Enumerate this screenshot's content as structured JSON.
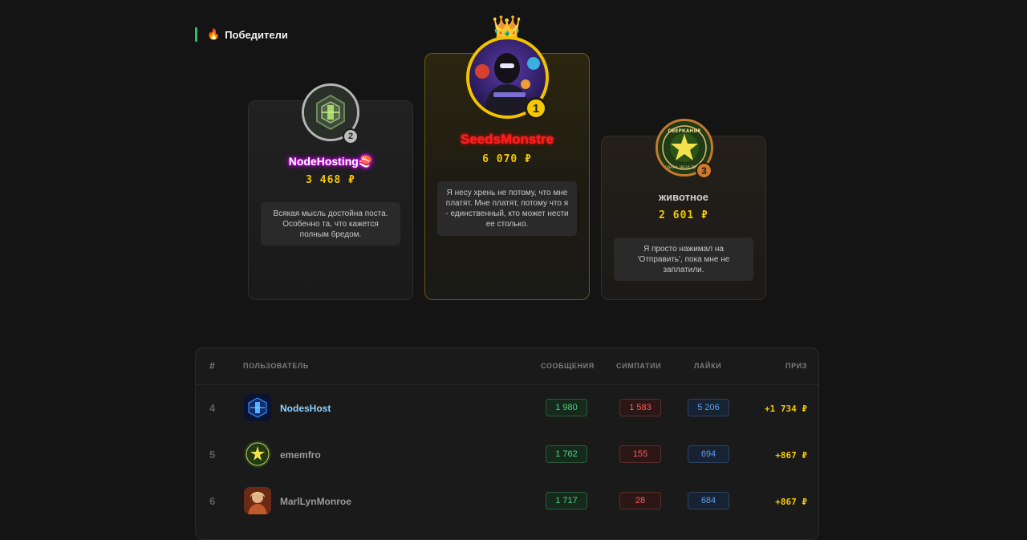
{
  "section": {
    "icon": "fire-icon",
    "icon_glyph": "🔥",
    "title": "Победители"
  },
  "podium": {
    "crown_glyph": "👑",
    "first": {
      "rank": "1",
      "name": "SeedsMonstre",
      "prize": "6 070 ₽",
      "quote": "Я несу хрень не потому, что мне платят. Мне платят, потому что я - единственный, кто может нести ее столько."
    },
    "second": {
      "rank": "2",
      "name": "NodeHosting🍣",
      "prize": "3 468 ₽",
      "quote": "Всякая мысль достойна поста. Особенно та, что кажется полным бредом."
    },
    "third": {
      "rank": "3",
      "name": "животное",
      "prize": "2 601 ₽",
      "quote": "Я просто нажимал на 'Отправить', пока мне не заплатили."
    },
    "third_avatar_text_top": "СВЕРКАНИЕ",
    "third_avatar_text_bottom": "ПРОДАЖА ЗВЕЗД ТЕЛЕГРАМ"
  },
  "table": {
    "headers": {
      "rank": "#",
      "user": "ПОЛЬЗОВАТЕЛЬ",
      "messages": "СООБЩЕНИЯ",
      "sympathies": "СИМПАТИИ",
      "likes": "ЛАЙКИ",
      "prize": "ПРИЗ"
    },
    "rows": [
      {
        "rank": "4",
        "user": "NodesHost",
        "messages": "1 980",
        "sympathies": "1 583",
        "likes": "5 206",
        "prize": "+1 734 ₽"
      },
      {
        "rank": "5",
        "user": "ememfro",
        "messages": "1 762",
        "sympathies": "155",
        "likes": "694",
        "prize": "+867 ₽"
      },
      {
        "rank": "6",
        "user": "MarlLynMonroe",
        "messages": "1 717",
        "sympathies": "28",
        "likes": "684",
        "prize": "+867 ₽"
      }
    ]
  },
  "colors": {
    "gold": "#f5c800",
    "silver": "#b5b5b5",
    "bronze": "#c77a2e",
    "accent_green": "#2fbf6b"
  }
}
